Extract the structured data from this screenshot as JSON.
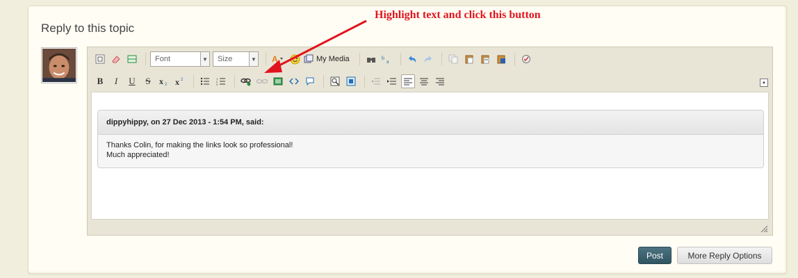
{
  "reply": {
    "title": "Reply to this topic"
  },
  "toolbar": {
    "font_placeholder": "Font",
    "size_placeholder": "Size",
    "my_media_label": "My Media"
  },
  "quote": {
    "header": "dippyhippy, on 27 Dec 2013 - 1:54 PM, said:",
    "lines": [
      "Thanks Colin, for making the links look so professional!",
      "Much appreciated!"
    ]
  },
  "annotation": {
    "text": "Highlight text and click this button"
  },
  "actions": {
    "post_label": "Post",
    "more_options_label": "More Reply Options"
  },
  "colors": {
    "annotation": "#e0141e",
    "post_button": "#3a5f6c",
    "page_background": "#f1eedd"
  }
}
